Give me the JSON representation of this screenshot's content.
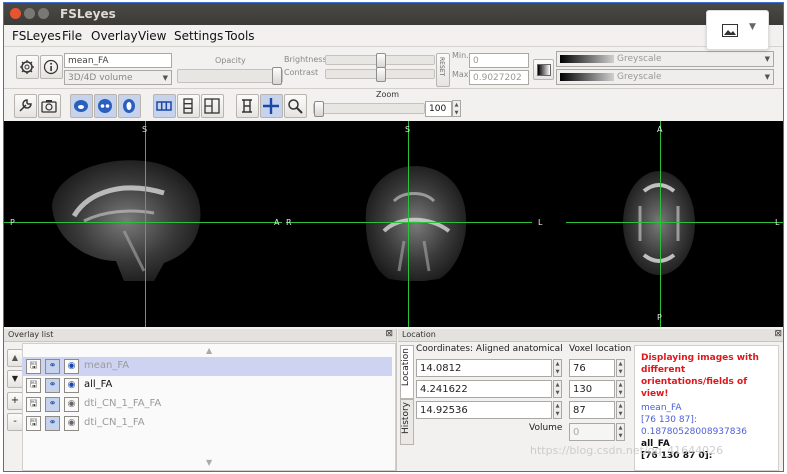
{
  "window": {
    "title": "FSLeyes"
  },
  "menubar": {
    "items": [
      "FSLeyes",
      "File",
      "Overlay",
      "View",
      "Settings",
      "Tools"
    ]
  },
  "overlay_toolbar": {
    "overlay_name": "mean_FA",
    "volume_type": "3D/4D volume",
    "opacity_label": "Opacity",
    "brightness_label": "Brightness",
    "contrast_label": "Contrast",
    "reset_label": "RESET",
    "min_label": "Min.",
    "max_label": "Max.",
    "min_value": "0",
    "max_value": "0.9027202",
    "cmap1": "Greyscale",
    "cmap2": "Greyscale"
  },
  "ortho_toolbar": {
    "zoom_label": "Zoom",
    "zoom_value": "100"
  },
  "viewer": {
    "sagittal": {
      "top": "S",
      "left": "P",
      "right": "A"
    },
    "coronal": {
      "top": "S",
      "left": "R",
      "right": "L"
    },
    "axial": {
      "top": "A",
      "bottom": "P",
      "right": "L"
    }
  },
  "overlay_list": {
    "title": "Overlay list",
    "items": [
      {
        "name": "mean_FA",
        "selected": true,
        "visible": true
      },
      {
        "name": "all_FA",
        "selected": false,
        "visible": true
      },
      {
        "name": "dti_CN_1_FA_FA",
        "selected": false,
        "visible": false
      },
      {
        "name": "dti_CN_1_FA",
        "selected": false,
        "visible": false
      }
    ]
  },
  "location": {
    "title": "Location",
    "tab_location": "Location",
    "tab_history": "History",
    "coords_header": "Coordinates: Aligned anatomical",
    "voxel_header": "Voxel location",
    "coords": [
      "14.0812",
      "4.241622",
      "14.92536"
    ],
    "voxels": [
      "76",
      "130",
      "87"
    ],
    "volume_label": "Volume",
    "volume_value": "0",
    "info_warning": "Displaying images with different orientations/fields of view!",
    "info_lines": [
      {
        "text": "mean_FA",
        "color": "#4c5fd6"
      },
      {
        "text": "[76 130 87]:",
        "color": "#4c5fd6"
      },
      {
        "text": "0.18780528008937836",
        "color": "#4c5fd6"
      },
      {
        "text": "all_FA",
        "color": "#111111"
      },
      {
        "text": "[76 130 87 0]:",
        "color": "#111111"
      }
    ]
  },
  "watermark": "https://blog.csdn.net/qq_41644026"
}
